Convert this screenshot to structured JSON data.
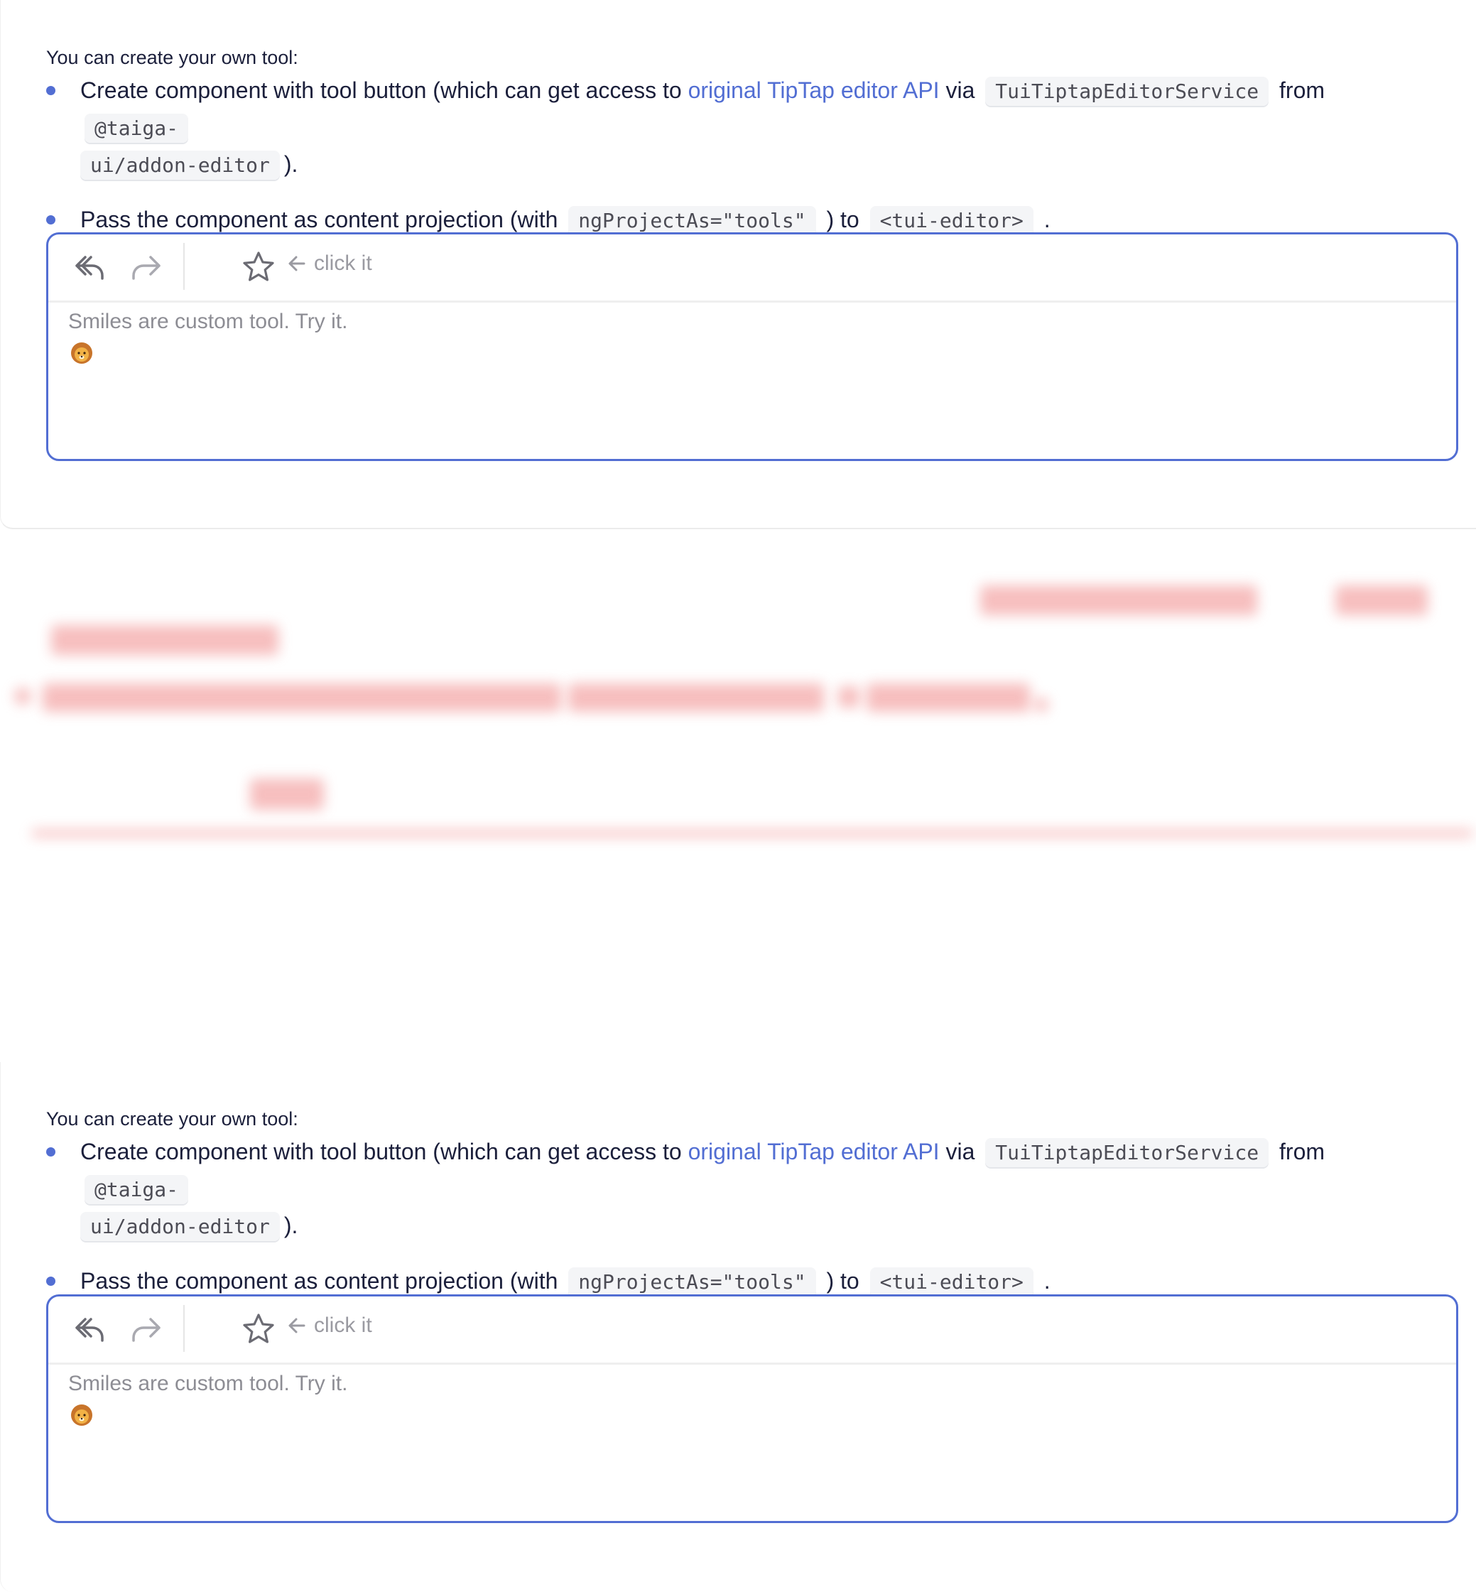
{
  "intro": "You can create your own tool:",
  "bullets": {
    "b1_text_a": "Create component with tool button (which can get access to",
    "b1_link": "original TipTap editor API",
    "b1_text_b": "via",
    "b1_code1": "TuiTiptapEditorService",
    "b1_text_c": "from",
    "b1_code2a": "@taiga-",
    "b1_code2b": "ui/addon-editor",
    "b1_text_d": ").",
    "b2_text_a": "Pass the component as content projection (with",
    "b2_code1": "ngProjectAs=\"tools\"",
    "b2_text_b": ") to",
    "b2_code2": "<tui-editor>",
    "b2_text_c": "."
  },
  "editor": {
    "undo_icon": "undo-icon",
    "redo_icon": "redo-icon",
    "star_icon": "star-icon",
    "arrow_icon": "arrow-left-icon",
    "hint": "click it",
    "content_text": "Smiles are custom tool. Try it.",
    "emoji": "lion-face-emoji"
  },
  "colors": {
    "accent": "#526ed3",
    "border": "#526ed3",
    "blur_red": "#f08a8a"
  }
}
